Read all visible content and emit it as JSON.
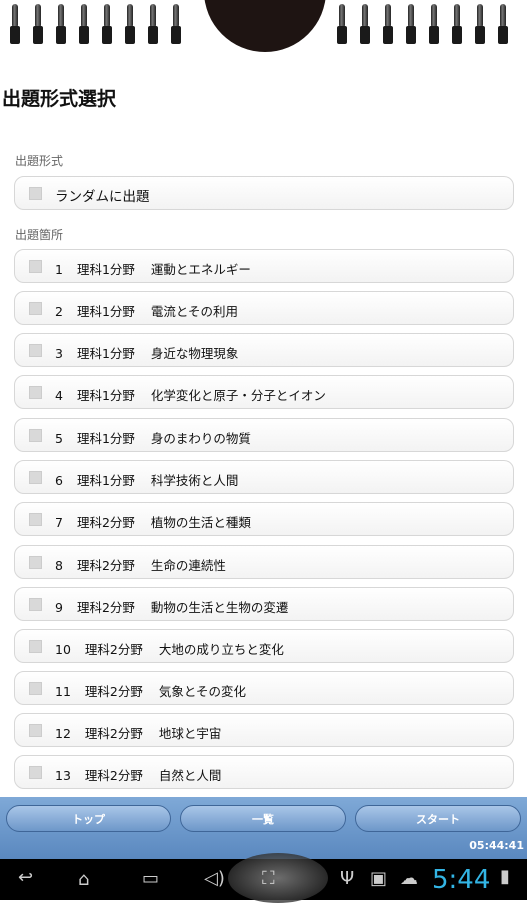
{
  "header": {
    "title": "出題形式選択"
  },
  "section_format": {
    "label": "出題形式",
    "random_label": "ランダムに出題"
  },
  "section_range": {
    "label": "出題箇所",
    "items": [
      {
        "num": "1",
        "field": "理科1分野",
        "topic": "運動とエネルギー"
      },
      {
        "num": "2",
        "field": "理科1分野",
        "topic": "電流とその利用"
      },
      {
        "num": "3",
        "field": "理科1分野",
        "topic": "身近な物理現象"
      },
      {
        "num": "4",
        "field": "理科1分野",
        "topic": "化学変化と原子・分子とイオン"
      },
      {
        "num": "5",
        "field": "理科1分野",
        "topic": "身のまわりの物質"
      },
      {
        "num": "6",
        "field": "理科1分野",
        "topic": "科学技術と人間"
      },
      {
        "num": "7",
        "field": "理科2分野",
        "topic": "植物の生活と種類"
      },
      {
        "num": "8",
        "field": "理科2分野",
        "topic": "生命の連続性"
      },
      {
        "num": "9",
        "field": "理科2分野",
        "topic": "動物の生活と生物の変遷"
      },
      {
        "num": "10",
        "field": "理科2分野",
        "topic": "大地の成り立ちと変化"
      },
      {
        "num": "11",
        "field": "理科2分野",
        "topic": "気象とその変化"
      },
      {
        "num": "12",
        "field": "理科2分野",
        "topic": "地球と宇宙"
      },
      {
        "num": "13",
        "field": "理科2分野",
        "topic": "自然と人間"
      }
    ]
  },
  "toolbar": {
    "top_label": "トップ",
    "list_label": "一覧",
    "start_label": "スタート",
    "time": "05:44:41"
  },
  "system_bar": {
    "clock": "5:44"
  },
  "colors": {
    "toolbar": "#6b97cb",
    "clock": "#33b5e5"
  }
}
